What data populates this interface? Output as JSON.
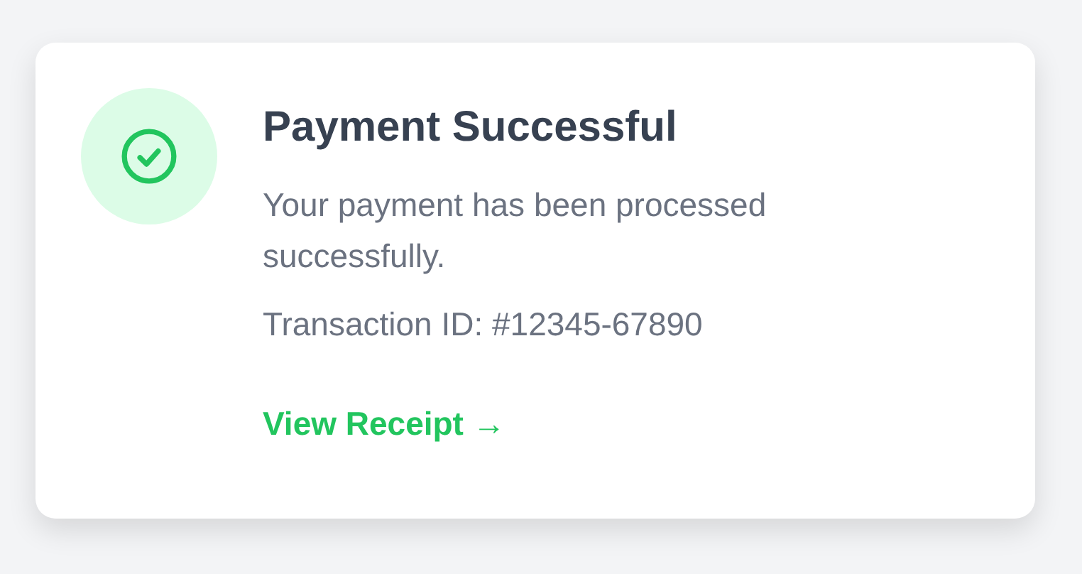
{
  "card": {
    "title": "Payment Successful",
    "message": "Your payment has been processed successfully.",
    "transaction": "Transaction ID: #12345-67890",
    "link": "View Receipt",
    "link_arrow": "→"
  }
}
